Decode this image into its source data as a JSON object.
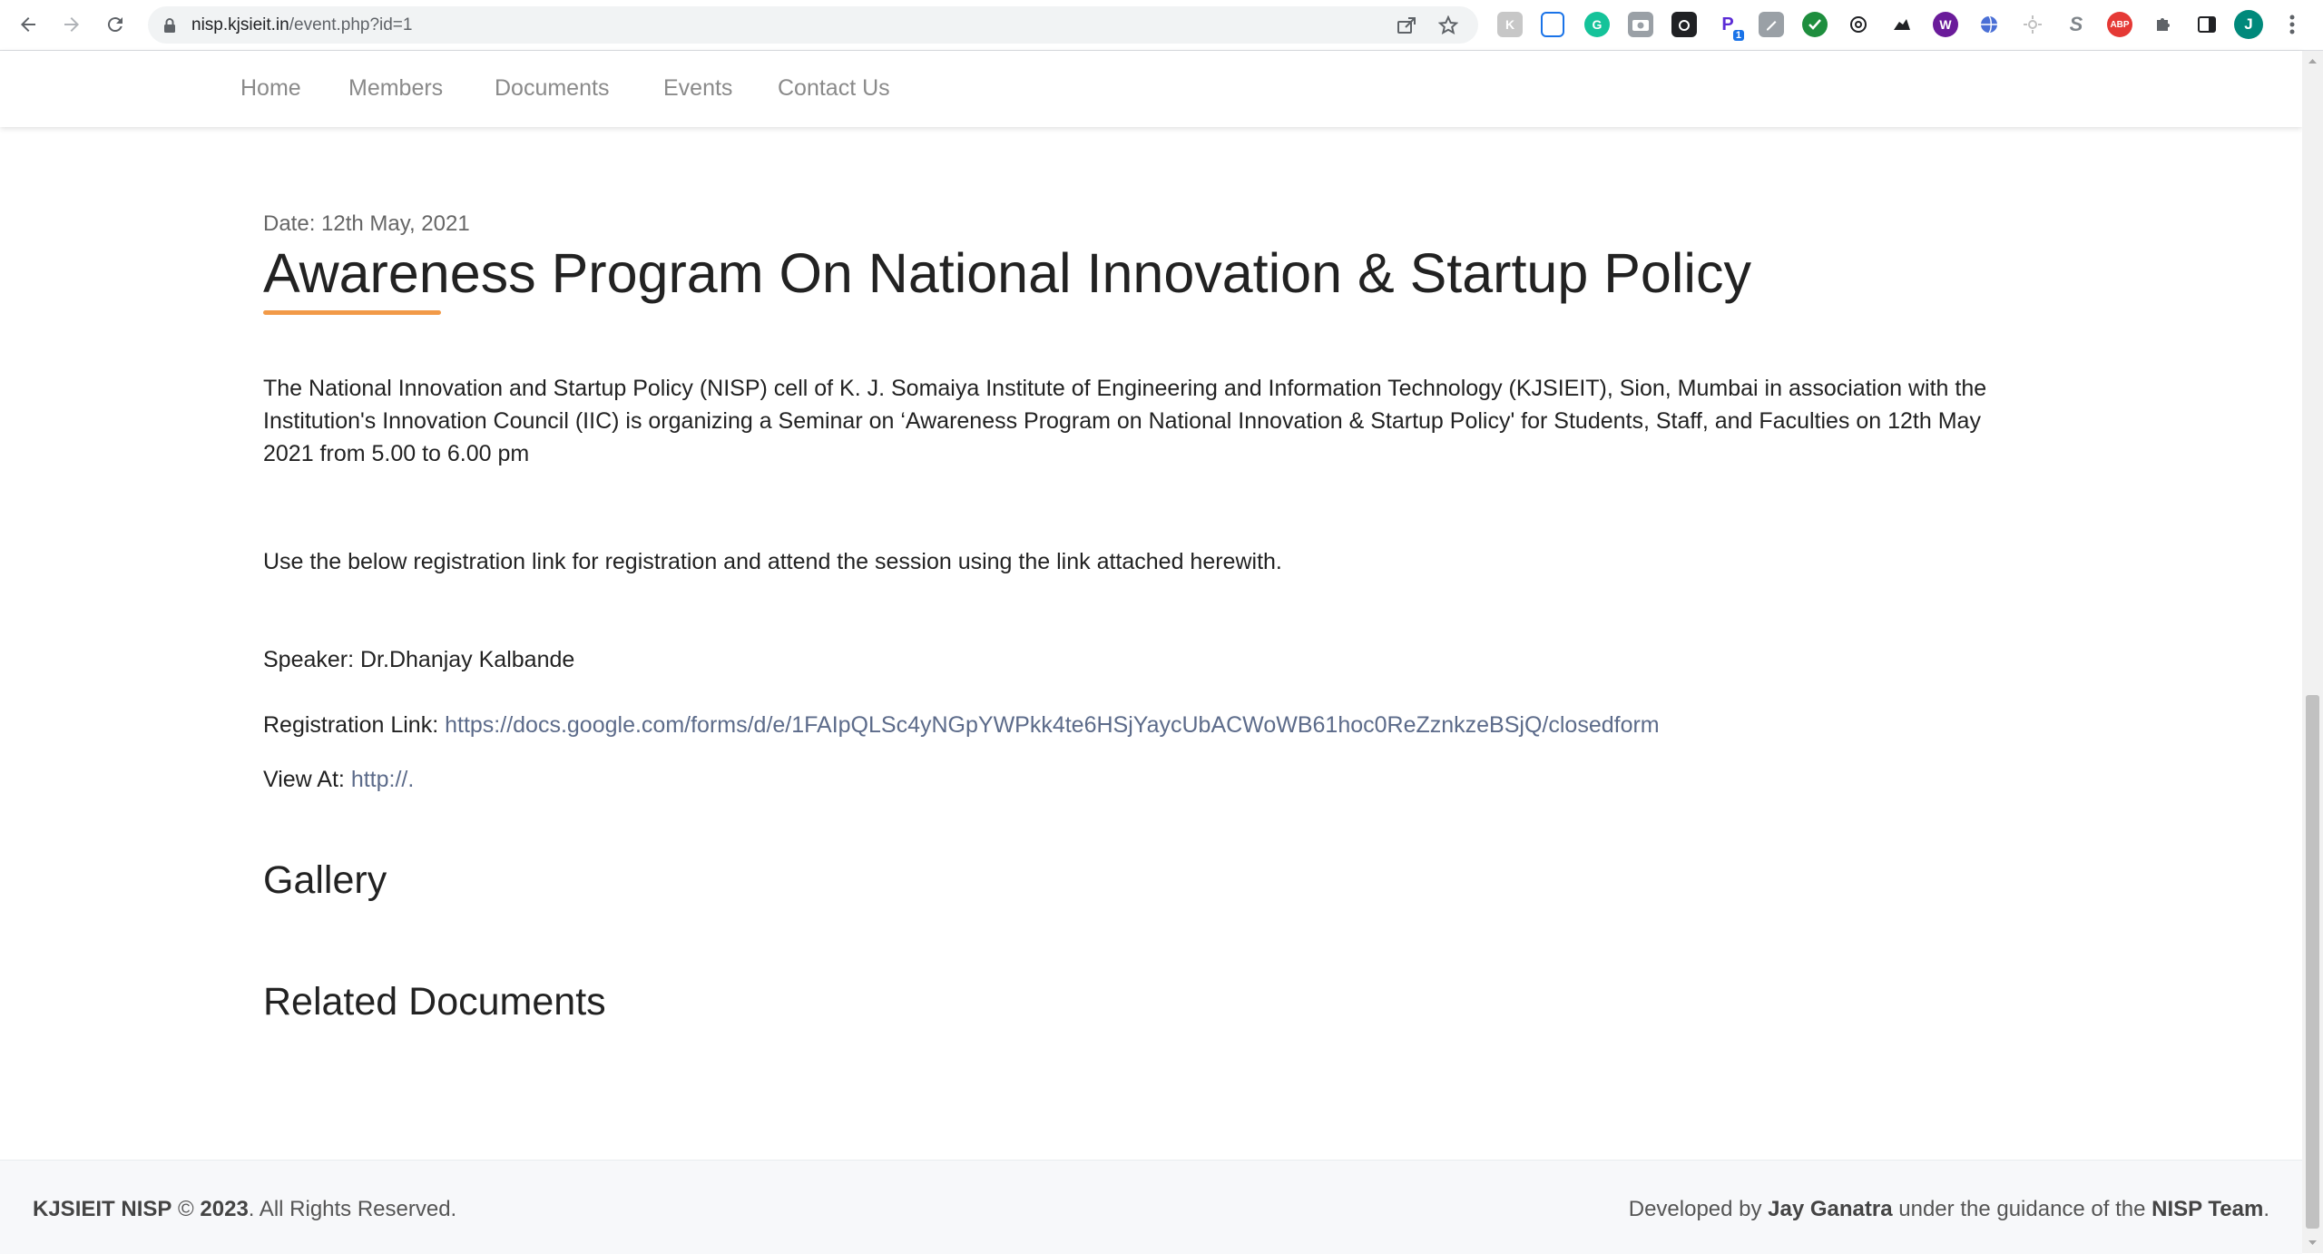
{
  "browser": {
    "url_domain": "nisp.kjsieit.in",
    "url_path": "/event.php?id=1",
    "extension_badge": "1",
    "avatar_letter": "J",
    "ext_labels": {
      "s": "S",
      "abp": "ABP",
      "p": "P"
    }
  },
  "nav": {
    "items": [
      "Home",
      "Members",
      "Documents",
      "Events",
      "Contact Us"
    ]
  },
  "event": {
    "date": "Date: 12th May, 2021",
    "title": "Awareness Program On National Innovation & Startup Policy",
    "description": "The National Innovation and Startup Policy (NISP) cell of K. J. Somaiya Institute of Engineering and Information Technology (KJSIEIT), Sion, Mumbai in association with the Institution's Innovation Council (IIC) is organizing a Seminar on ‘Awareness Program on National Innovation & Startup Policy' for Students, Staff, and Faculties on 12th May 2021 from 5.00 to 6.00 pm",
    "instruction": "Use the below registration link for registration and attend the session using the link attached herewith.",
    "speaker": "Speaker: Dr.Dhanjay Kalbande",
    "registration_label": "Registration Link:",
    "registration_link": "https://docs.google.com/forms/d/e/1FAIpQLSc4yNGpYWPkk4te6HSjYaycUbACWoWB61hoc0ReZznkzeBSjQ/closedform",
    "view_label": "View At:",
    "view_link": "http://."
  },
  "sections": {
    "gallery": "Gallery",
    "related_documents": "Related Documents"
  },
  "footer": {
    "brand": "KJSIEIT NISP",
    "copyright_symbol": "©",
    "year": "2023",
    "rights": ". All Rights Reserved.",
    "developed_by": "Developed by",
    "developer": "Jay Ganatra",
    "guidance": "under the guidance of the",
    "team": "NISP Team",
    "period": "."
  },
  "colors": {
    "accent_underline": "#f29a48",
    "link": "#5c6b8a",
    "nav_text": "#8a8a8a"
  }
}
